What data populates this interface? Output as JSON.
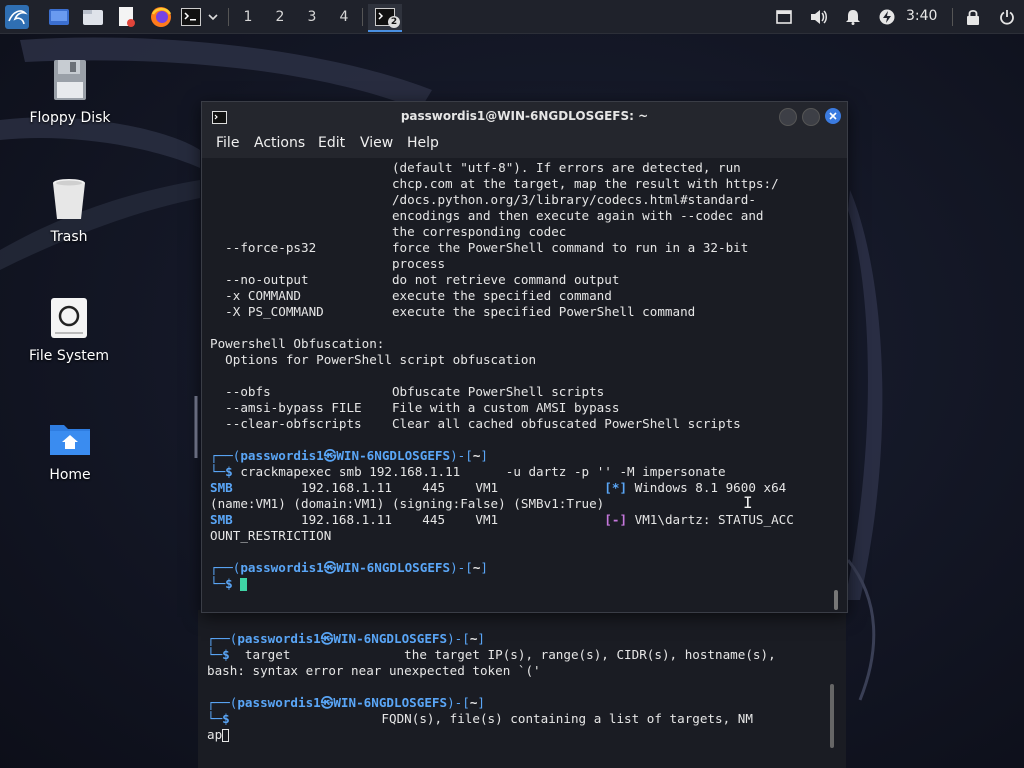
{
  "panel": {
    "workspaces": [
      "1",
      "2",
      "3",
      "4"
    ],
    "terminal_badge": "2",
    "clock": "3:40",
    "icons": [
      "kali-menu-icon",
      "desktop-icon",
      "file-manager-icon",
      "text-editor-icon",
      "firefox-icon",
      "terminal-icon",
      "chevron-down-icon",
      "window-icon",
      "volume-icon",
      "bell-icon",
      "power-bolt-icon",
      "lock-icon",
      "logout-icon"
    ]
  },
  "desktop": {
    "icons": [
      {
        "label": "Floppy Disk",
        "icon": "floppy-disk-icon"
      },
      {
        "label": "Trash",
        "icon": "trash-icon"
      },
      {
        "label": "File System",
        "icon": "hard-drive-icon"
      },
      {
        "label": "Home",
        "icon": "home-folder-icon"
      }
    ]
  },
  "window": {
    "title": "passwordis1@WIN-6NGDLOSGEFS: ~",
    "menu": [
      "File",
      "Actions",
      "Edit",
      "View",
      "Help"
    ]
  },
  "terminal": {
    "help_lines": [
      "                        (default \"utf-8\"). If errors are detected, run",
      "                        chcp.com at the target, map the result with https:/",
      "                        /docs.python.org/3/library/codecs.html#standard-",
      "                        encodings and then execute again with --codec and",
      "                        the corresponding codec",
      "  --force-ps32          force the PowerShell command to run in a 32-bit",
      "                        process",
      "  --no-output           do not retrieve command output",
      "  -x COMMAND            execute the specified command",
      "  -X PS_COMMAND         execute the specified PowerShell command",
      "",
      "Powershell Obfuscation:",
      "  Options for PowerShell script obfuscation",
      "",
      "  --obfs                Obfuscate PowerShell scripts",
      "  --amsi-bypass FILE    File with a custom AMSI bypass",
      "  --clear-obfscripts    Clear all cached obfuscated PowerShell scripts",
      ""
    ],
    "prompt_user": "passwordis1",
    "prompt_at": "㉿",
    "prompt_host": "WIN-6NGDLOSGEFS",
    "prompt_dir": "~",
    "command": "crackmapexec smb 192.168.1.11      -u dartz -p '' -M impersonate",
    "output": [
      {
        "proto": "SMB",
        "rest": "         192.168.1.11    445    VM1              ",
        "tag": "[*]",
        "msg": " Windows 8.1 9600 x64"
      },
      {
        "plain": "(name:VM1) (domain:VM1) (signing:False) (SMBv1:True)"
      },
      {
        "proto": "SMB",
        "rest": "         192.168.1.11    445    VM1              ",
        "tag": "[-]",
        "msg": " VM1\\dartz: STATUS_ACC"
      },
      {
        "plain": "OUNT_RESTRICTION"
      }
    ]
  },
  "bg_terminal": {
    "line1_cmd": "  target               the target IP(s), range(s), CIDR(s), hostname(s),",
    "line2": "bash: syntax error near unexpected token `('",
    "line3_cmd": "                    FQDN(s), file(s) containing a list of targets, NM",
    "line4": "ap"
  }
}
